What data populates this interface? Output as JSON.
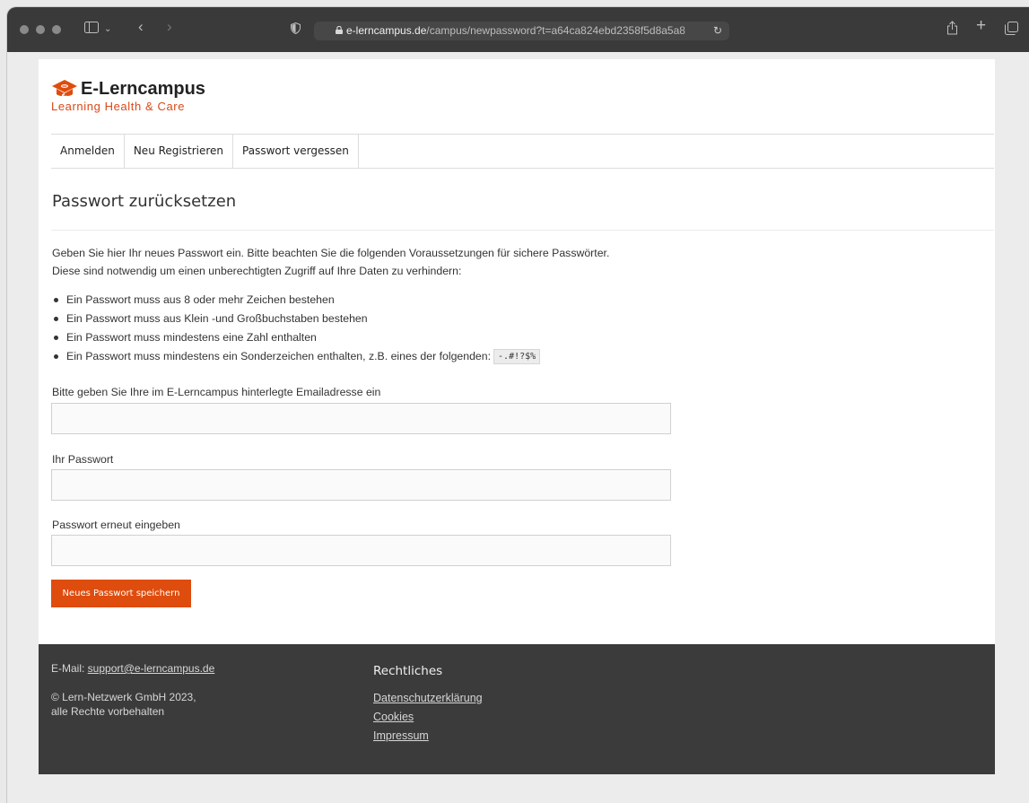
{
  "browser": {
    "url_host": "e-lerncampus.de",
    "url_path": "/campus/newpassword?t=a64ca824ebd2358f5d8a5a8",
    "reload_icon": "reload-icon",
    "share_icon": "share-icon",
    "new_tab_icon": "plus-icon",
    "tabs_icon": "tab-overview-icon"
  },
  "logo": {
    "title": "E-Lerncampus",
    "subtitle": "Learning Health & Care",
    "accent_color": "#de4c0e"
  },
  "nav": {
    "items": [
      {
        "label": "Anmelden"
      },
      {
        "label": "Neu Registrieren"
      },
      {
        "label": "Passwort vergessen"
      }
    ]
  },
  "main": {
    "heading": "Passwort zurücksetzen",
    "intro_line1": "Geben Sie hier Ihr neues Passwort ein. Bitte beachten Sie die folgenden Voraussetzungen für sichere Passwörter.",
    "intro_line2": "Diese sind notwendig um einen unberechtigten Zugriff auf Ihre Daten zu verhindern:",
    "requirements": [
      "Ein Passwort muss aus 8 oder mehr Zeichen bestehen",
      "Ein Passwort muss aus Klein -und Großbuchstaben bestehen",
      "Ein Passwort muss mindestens eine Zahl enthalten",
      "Ein Passwort muss mindestens ein Sonderzeichen enthalten, z.B. eines der folgenden:"
    ],
    "special_chars": "-.#!?$%",
    "email_label": "Bitte geben Sie Ihre im E-Lerncampus hinterlegte Emailadresse ein",
    "email_value": "",
    "password_label": "Ihr Passwort",
    "password_value": "",
    "password_repeat_label": "Passwort erneut eingeben",
    "password_repeat_value": "",
    "submit_label": "Neues Passwort speichern"
  },
  "footer": {
    "email_prefix": "E-Mail: ",
    "email": "support@e-lerncampus.de",
    "copyright_line1": "© Lern-Netzwerk GmbH 2023,",
    "copyright_line2": "alle Rechte vorbehalten",
    "legal_title": "Rechtliches",
    "legal_links": [
      {
        "label": "Datenschutzerklärung"
      },
      {
        "label": "Cookies"
      },
      {
        "label": "Impressum"
      }
    ]
  }
}
